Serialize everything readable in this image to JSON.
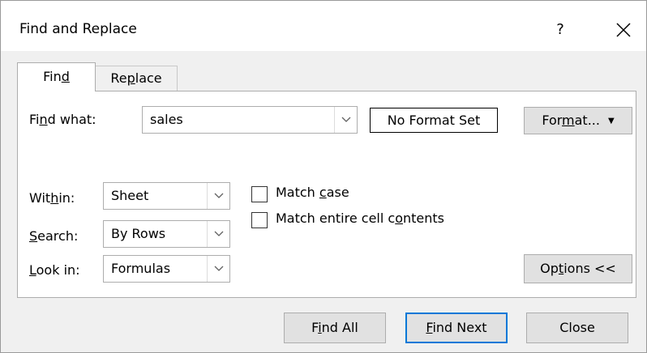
{
  "window": {
    "title": "Find and Replace",
    "help": "?",
    "close_icon": "close-icon"
  },
  "tabs": {
    "find": {
      "pre": "Fin",
      "key": "d",
      "post": ""
    },
    "replace": {
      "pre": "Re",
      "key": "p",
      "post": "lace"
    }
  },
  "find_what": {
    "label_pre": "Fi",
    "label_key": "n",
    "label_post": "d what:",
    "value": "sales",
    "format_preview": "No Format Set"
  },
  "format_button": {
    "pre": "For",
    "key": "m",
    "post": "at..."
  },
  "within": {
    "label_pre": "Wit",
    "label_key": "h",
    "label_post": "in:",
    "value": "Sheet"
  },
  "search": {
    "label_pre": "",
    "label_key": "S",
    "label_post": "earch:",
    "value": "By Rows"
  },
  "look_in": {
    "label_pre": "",
    "label_key": "L",
    "label_post": "ook in:",
    "value": "Formulas"
  },
  "match_case": {
    "pre": "Match ",
    "key": "c",
    "post": "ase",
    "checked": false
  },
  "match_entire": {
    "pre": "Match entire cell c",
    "key": "o",
    "post": "ntents",
    "checked": false
  },
  "options_button": {
    "pre": "Op",
    "key": "t",
    "post": "ions <<"
  },
  "buttons": {
    "find_all": {
      "pre": "F",
      "key": "i",
      "post": "nd All"
    },
    "find_next": {
      "pre": "",
      "key": "F",
      "post": "ind Next"
    },
    "close": "Close"
  }
}
